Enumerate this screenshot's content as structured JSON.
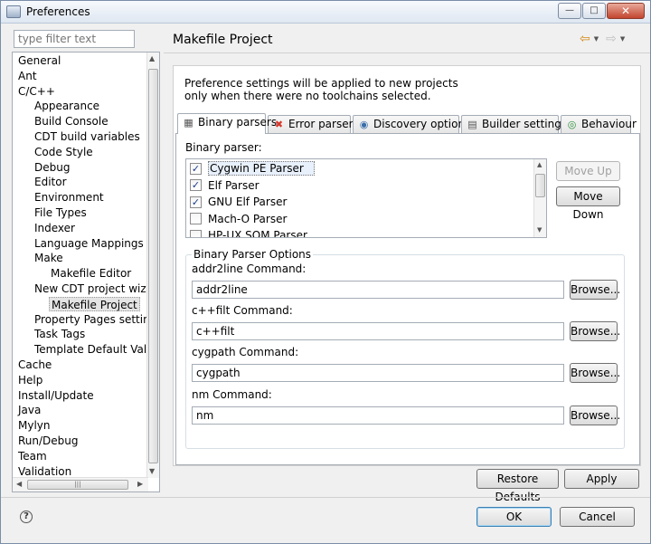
{
  "window": {
    "title": "Preferences",
    "minimize_glyph": "—",
    "maximize_glyph": "□",
    "close_glyph": "✕"
  },
  "filter": {
    "placeholder": "type filter text"
  },
  "tree": [
    {
      "label": "General",
      "level": 0
    },
    {
      "label": "Ant",
      "level": 0
    },
    {
      "label": "C/C++",
      "level": 0
    },
    {
      "label": "Appearance",
      "level": 1
    },
    {
      "label": "Build Console",
      "level": 1
    },
    {
      "label": "CDT build variables",
      "level": 1
    },
    {
      "label": "Code Style",
      "level": 1
    },
    {
      "label": "Debug",
      "level": 1
    },
    {
      "label": "Editor",
      "level": 1
    },
    {
      "label": "Environment",
      "level": 1
    },
    {
      "label": "File Types",
      "level": 1
    },
    {
      "label": "Indexer",
      "level": 1
    },
    {
      "label": "Language Mappings",
      "level": 1
    },
    {
      "label": "Make",
      "level": 1
    },
    {
      "label": "Makefile Editor",
      "level": 2
    },
    {
      "label": "New CDT project wizard",
      "level": 1
    },
    {
      "label": "Makefile Project",
      "level": 2,
      "selected": true
    },
    {
      "label": "Property Pages settings",
      "level": 1
    },
    {
      "label": "Task Tags",
      "level": 1
    },
    {
      "label": "Template Default Values",
      "level": 1
    },
    {
      "label": "Cache",
      "level": 0
    },
    {
      "label": "Help",
      "level": 0
    },
    {
      "label": "Install/Update",
      "level": 0
    },
    {
      "label": "Java",
      "level": 0
    },
    {
      "label": "Mylyn",
      "level": 0
    },
    {
      "label": "Run/Debug",
      "level": 0
    },
    {
      "label": "Team",
      "level": 0
    },
    {
      "label": "Validation",
      "level": 0
    }
  ],
  "page": {
    "title": "Makefile Project",
    "back_glyph": "⇦",
    "forward_glyph": "⇨",
    "menu_glyph": "▼",
    "notice_line1": "Preference settings will be applied to new projects",
    "notice_line2": "only when there were no toolchains selected."
  },
  "tabs": [
    {
      "label": "Binary parsers",
      "icon": "binary-icon",
      "glyph": "▦",
      "color": "#555555",
      "active": true
    },
    {
      "label": "Error parsers",
      "icon": "error-icon",
      "glyph": "✖",
      "color": "#d8362a"
    },
    {
      "label": "Discovery options",
      "icon": "globe-icon",
      "glyph": "◉",
      "color": "#3a6fa8"
    },
    {
      "label": "Builder settings",
      "icon": "builder-icon",
      "glyph": "▤",
      "color": "#555555"
    },
    {
      "label": "Behaviour",
      "icon": "behaviour-icon",
      "glyph": "◎",
      "color": "#2f8f3a"
    }
  ],
  "binary": {
    "label": "Binary parser:",
    "parsers": [
      {
        "label": "Cygwin PE Parser",
        "checked": true,
        "selected": true
      },
      {
        "label": "Elf Parser",
        "checked": true
      },
      {
        "label": "GNU Elf Parser",
        "checked": true
      },
      {
        "label": "Mach-O Parser",
        "checked": false
      },
      {
        "label": "HP-UX SOM Parser",
        "checked": false
      }
    ],
    "move_up": "Move Up",
    "move_down": "Move Down",
    "check_glyph": "✓"
  },
  "options": {
    "group_title": "Binary Parser Options",
    "browse": "Browse...",
    "fields": [
      {
        "label": "addr2line Command:",
        "value": "addr2line"
      },
      {
        "label": "c++filt Command:",
        "value": "c++filt"
      },
      {
        "label": "cygpath Command:",
        "value": "cygpath"
      },
      {
        "label": "nm Command:",
        "value": "nm"
      }
    ]
  },
  "footer": {
    "restore_defaults": "Restore Defaults",
    "apply": "Apply",
    "ok": "OK",
    "cancel": "Cancel",
    "help_glyph": "?"
  }
}
